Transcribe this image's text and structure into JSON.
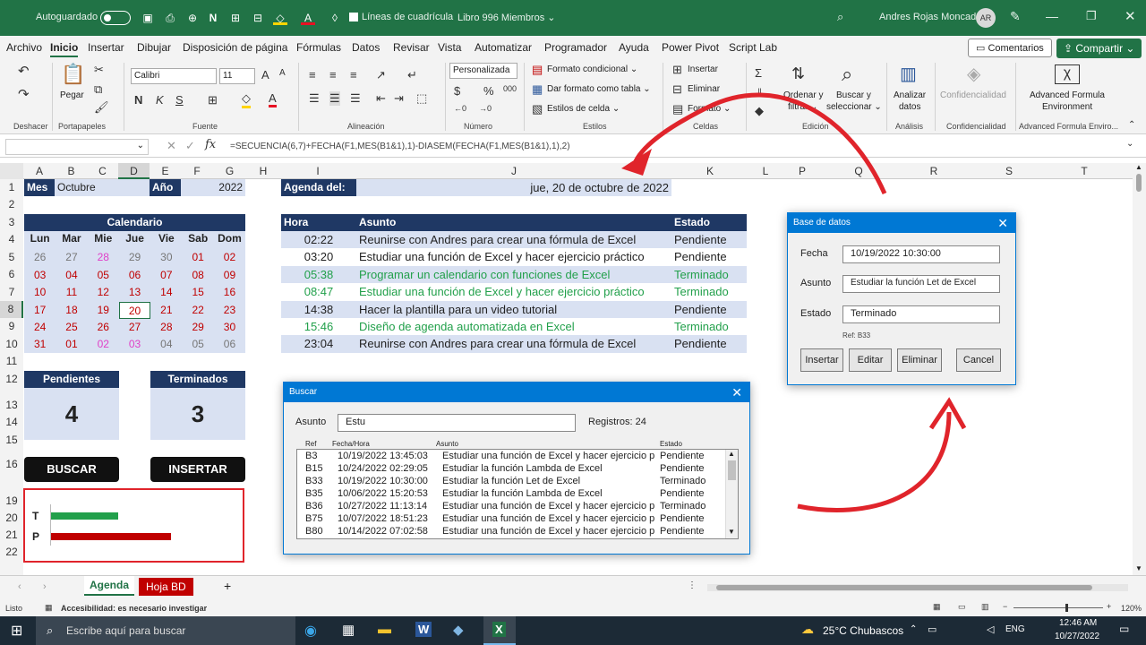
{
  "title_bar": {
    "autosave": "Autoguardado",
    "gridlines": "Líneas de cuadrícula",
    "book": "Libro 996 Miembros ⌄",
    "user": "Andres Rojas Moncada",
    "initials": "AR"
  },
  "tabs": [
    "Archivo",
    "Inicio",
    "Insertar",
    "Dibujar",
    "Disposición de página",
    "Fórmulas",
    "Datos",
    "Revisar",
    "Vista",
    "Automatizar",
    "Programador",
    "Ayuda",
    "Power Pivot",
    "Script Lab"
  ],
  "ribbon": {
    "comentarios": "Comentarios",
    "compartir": "Compartir",
    "deshacer": "Deshacer",
    "pegar": "Pegar",
    "portapapeles": "Portapapeles",
    "font_name": "Calibri",
    "font_size": "11",
    "fuente": "Fuente",
    "alineacion": "Alineación",
    "num_format": "Personalizada",
    "numero": "Número",
    "cond_format": "Formato condicional ⌄",
    "table_format": "Dar formato como tabla ⌄",
    "cell_styles": "Estilos de celda ⌄",
    "estilos": "Estilos",
    "insertar": "Insertar",
    "eliminar": "Eliminar",
    "formato": "Formato ⌄",
    "celdas": "Celdas",
    "ordenar": "Ordenar y",
    "filtrar": "filtrar ⌄",
    "buscar": "Buscar y",
    "seleccionar": "seleccionar ⌄",
    "edicion": "Edición",
    "analizar": "Analizar",
    "datos": "datos",
    "analisis": "Análisis",
    "confidencialidad": "Confidencialidad",
    "afe1": "Advanced Formula",
    "afe2": "Environment",
    "afe3": "Advanced Formula Enviro..."
  },
  "formula": "=SECUENCIA(6,7)+FECHA(F1,MES(B1&1),1)-DIASEM(FECHA(F1,MES(B1&1),1),2)",
  "columns": [
    "A",
    "B",
    "C",
    "D",
    "E",
    "F",
    "G",
    "H",
    "I",
    "J",
    "K",
    "L",
    "P",
    "Q",
    "R",
    "S",
    "T"
  ],
  "rows": [
    "1",
    "2",
    "3",
    "4",
    "5",
    "6",
    "7",
    "8",
    "9",
    "10",
    "11",
    "12",
    "13",
    "14",
    "15",
    "16",
    "19",
    "20",
    "21",
    "22"
  ],
  "top": {
    "mes_label": "Mes",
    "mes": "Octubre",
    "anio_label": "Año",
    "anio": "2022",
    "agenda_label": "Agenda del:",
    "agenda_date": "jue, 20 de octubre de 2022"
  },
  "calendar": {
    "title": "Calendario",
    "days": [
      "Lun",
      "Mar",
      "Mie",
      "Jue",
      "Vie",
      "Sab",
      "Dom"
    ],
    "weeks": [
      [
        "26",
        "27",
        "28",
        "29",
        "30",
        "01",
        "02"
      ],
      [
        "03",
        "04",
        "05",
        "06",
        "07",
        "08",
        "09"
      ],
      [
        "10",
        "11",
        "12",
        "13",
        "14",
        "15",
        "16"
      ],
      [
        "17",
        "18",
        "19",
        "20",
        "21",
        "22",
        "23"
      ],
      [
        "24",
        "25",
        "26",
        "27",
        "28",
        "29",
        "30"
      ],
      [
        "31",
        "01",
        "02",
        "03",
        "04",
        "05",
        "06"
      ]
    ]
  },
  "counters": {
    "pend_label": "Pendientes",
    "pend": "4",
    "term_label": "Terminados",
    "term": "3"
  },
  "buttons": {
    "buscar": "BUSCAR",
    "insertar": "INSERTAR"
  },
  "bars": {
    "t_label": "T",
    "p_label": "P",
    "t_value": 3,
    "p_value": 4
  },
  "agenda": {
    "headers": [
      "Hora",
      "Asunto",
      "Estado"
    ],
    "rows": [
      [
        "02:22",
        "Reunirse con Andres para crear una fórmula de Excel",
        "Pendiente"
      ],
      [
        "03:20",
        "Estudiar una función de Excel y hacer ejercicio práctico",
        "Pendiente"
      ],
      [
        "05:38",
        "Programar un calendario con funciones de Excel",
        "Terminado"
      ],
      [
        "08:47",
        "Estudiar una función de Excel y hacer ejercicio práctico",
        "Terminado"
      ],
      [
        "14:38",
        "Hacer la plantilla para un video tutorial",
        "Pendiente"
      ],
      [
        "15:46",
        "Diseño de agenda automatizada en Excel",
        "Terminado"
      ],
      [
        "23:04",
        "Reunirse con Andres para crear una fórmula de Excel",
        "Pendiente"
      ]
    ]
  },
  "db_dialog": {
    "title": "Base de datos",
    "fecha_label": "Fecha",
    "fecha": "10/19/2022 10:30:00",
    "asunto_label": "Asunto",
    "asunto": "Estudiar la función Let de Excel",
    "estado_label": "Estado",
    "estado": "Terminado",
    "ref": "Ref: B33",
    "b_insertar": "Insertar",
    "b_editar": "Editar",
    "b_eliminar": "Eliminar",
    "b_cancel": "Cancel"
  },
  "search_dialog": {
    "title": "Buscar",
    "asunto_label": "Asunto",
    "query": "Estu",
    "registros": "Registros: 24",
    "headers": [
      "Ref",
      "Fecha/Hora",
      "Asunto",
      "Estado"
    ],
    "rows": [
      [
        "B3",
        "10/19/2022 13:45:03",
        "Estudiar una función de Excel y hacer ejercicio p",
        "Pendiente"
      ],
      [
        "B15",
        "10/24/2022 02:29:05",
        "Estudiar la función Lambda de Excel",
        "Pendiente"
      ],
      [
        "B33",
        "10/19/2022 10:30:00",
        "Estudiar la función Let de Excel",
        "Terminado"
      ],
      [
        "B35",
        "10/06/2022 15:20:53",
        "Estudiar la función Lambda de Excel",
        "Pendiente"
      ],
      [
        "B36",
        "10/27/2022 11:13:14",
        "Estudiar una función de Excel y hacer ejercicio p",
        "Terminado"
      ],
      [
        "B75",
        "10/07/2022 18:51:23",
        "Estudiar una función de Excel y hacer ejercicio p",
        "Pendiente"
      ],
      [
        "B80",
        "10/14/2022 07:02:58",
        "Estudiar una función de Excel y hacer ejercicio p",
        "Pendiente"
      ]
    ]
  },
  "sheets": [
    "Agenda",
    "Hoja BD"
  ],
  "status": {
    "ready": "Listo",
    "access": "Accesibilidad: es necesario investigar",
    "zoom": "120%"
  },
  "taskbar": {
    "search": "Escribe aquí para buscar",
    "weather": "25°C  Chubascos",
    "lang": "ENG",
    "time": "12:46 AM",
    "date": "10/27/2022"
  },
  "colors": {
    "navy": "#1f3864",
    "light_blue": "#d9e1f2",
    "green": "#22a04b",
    "red": "#c00000",
    "pink": "#e040c8",
    "excel_green": "#217346"
  }
}
